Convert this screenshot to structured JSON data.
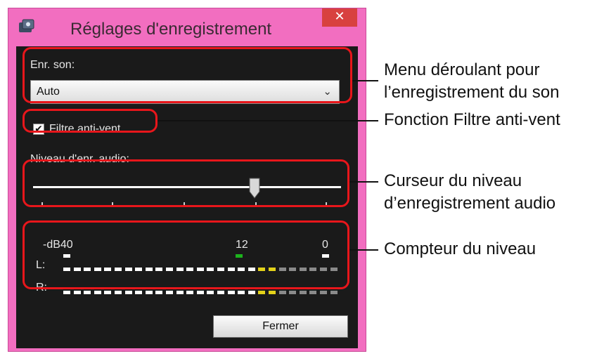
{
  "window": {
    "title": "Réglages d'enregistrement",
    "close_symbol": "✕",
    "frame_color": "#f26ec0"
  },
  "audio": {
    "sound_label": "Enr. son:",
    "sound_value": "Auto",
    "wind_filter_label": "Filtre anti-vent",
    "wind_filter_checked": true,
    "level_label": "Niveau d'enr. audio:",
    "level_fraction": 0.75
  },
  "meter": {
    "scale_left": "-dB40",
    "scale_mid": "12",
    "scale_right": "0",
    "left_channel": "L:",
    "right_channel": "R:"
  },
  "buttons": {
    "close_label": "Fermer"
  },
  "callouts": {
    "dropdown_line1": "Menu déroulant pour",
    "dropdown_line2": "l’enregistrement du son",
    "wind_filter": "Fonction Filtre anti-vent",
    "slider_line1": "Curseur du niveau",
    "slider_line2": "d’enregistrement audio",
    "meter": "Compteur du niveau"
  },
  "colors": {
    "highlight": "#e8161b",
    "meter_on": "#ffffff",
    "meter_yellow": "#e3d21a",
    "meter_off": "#8a8a8a",
    "meter_green": "#1db31d"
  }
}
